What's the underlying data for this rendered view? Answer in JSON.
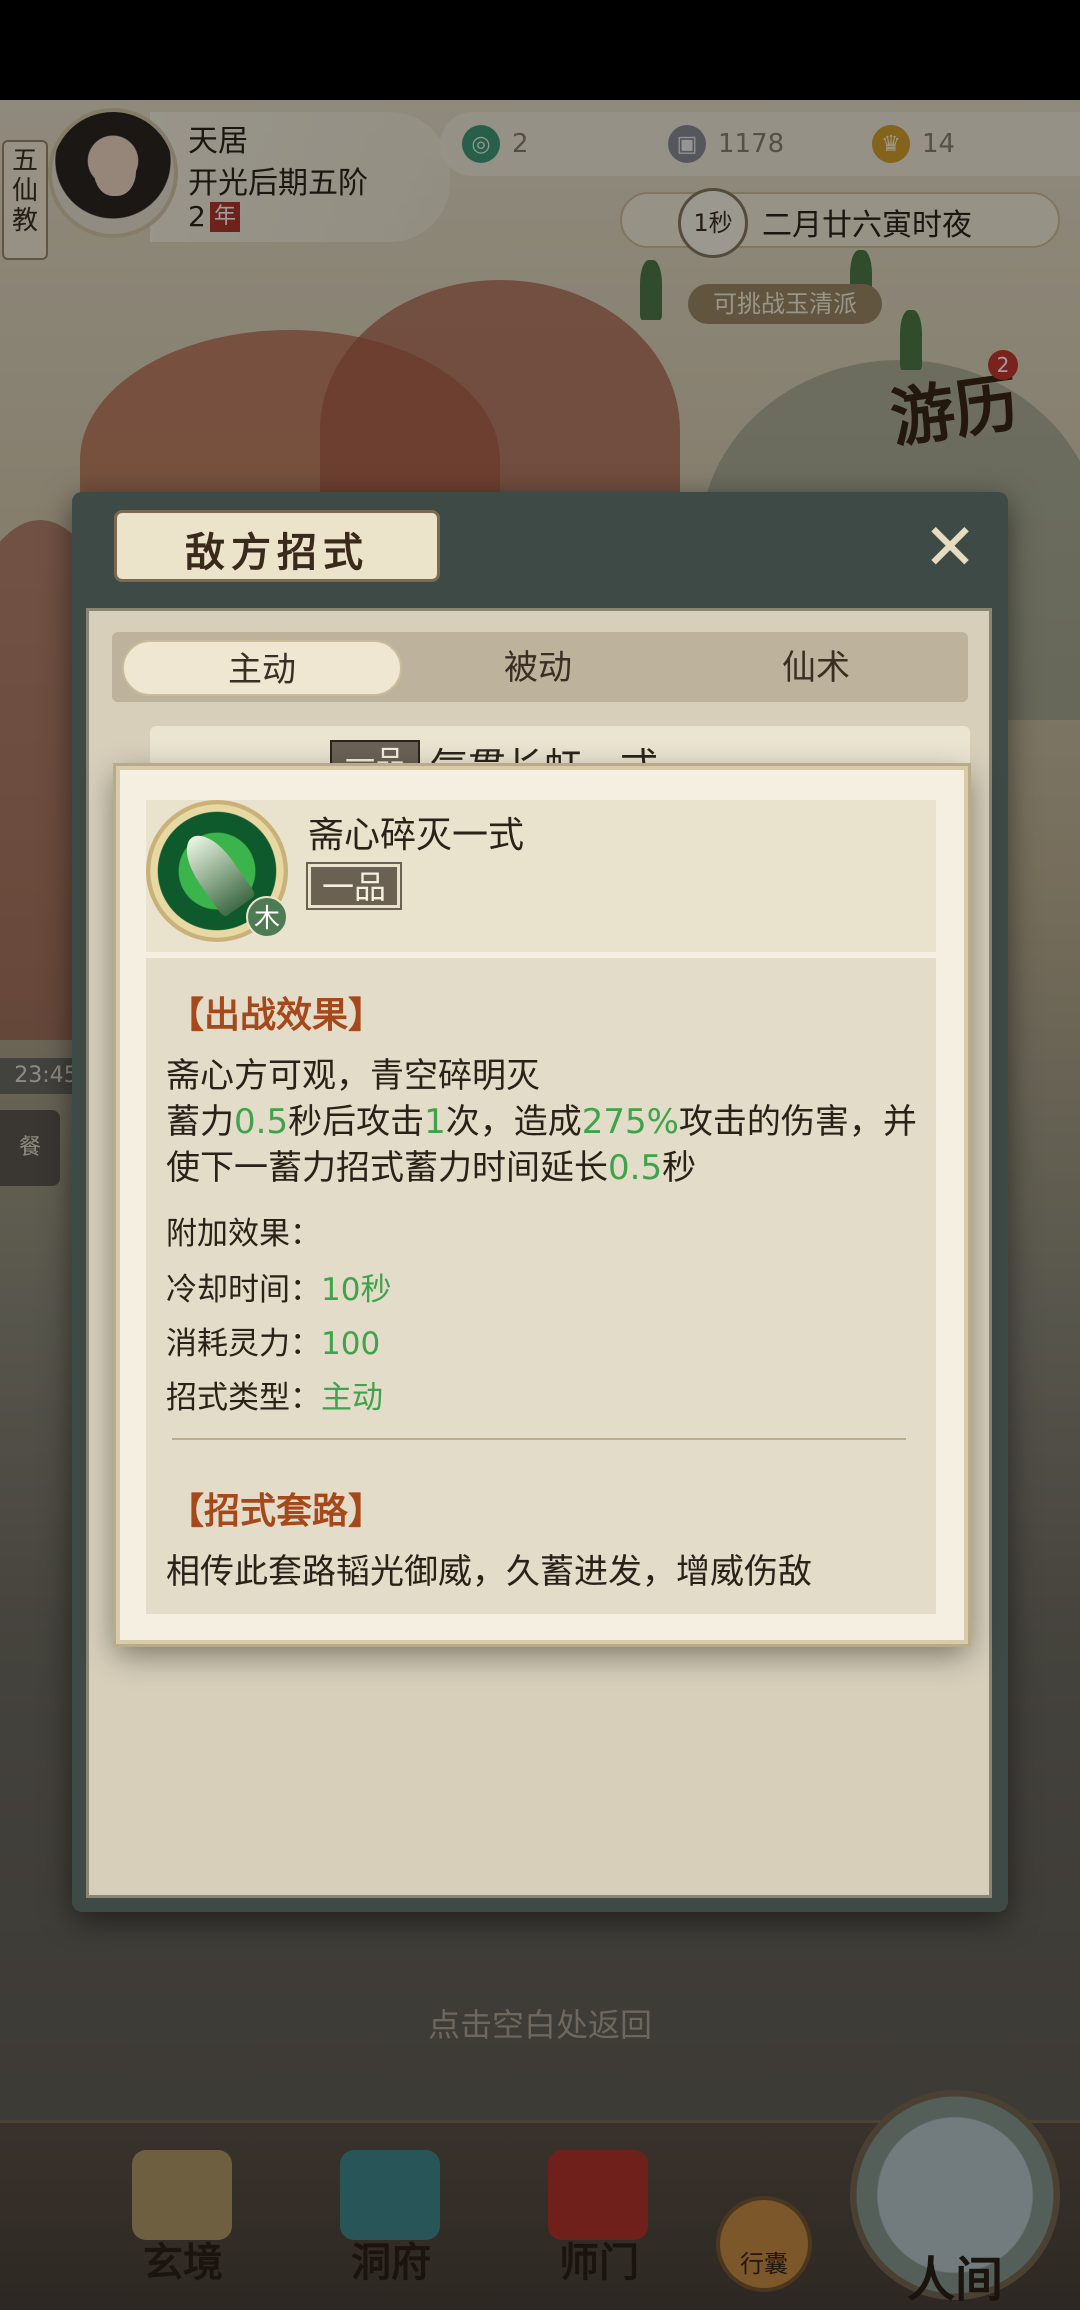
{
  "header": {
    "sect": "五仙教",
    "player": {
      "name": "天居",
      "realm": "开光后期五阶",
      "age": "2",
      "age_unit": "年"
    },
    "resources": [
      {
        "icon": "jade-swirl-icon",
        "value": "2"
      },
      {
        "icon": "silver-coin-icon",
        "value": "1178"
      },
      {
        "icon": "gold-ingot-icon",
        "value": "14"
      }
    ],
    "time": {
      "seconds": "1秒",
      "label": "二月廿六寅时夜"
    },
    "challenge": "可挑战玉清派",
    "travel": {
      "label": "游历",
      "badge": "2"
    },
    "left_clock": "23:45",
    "left_btn": "餐"
  },
  "window": {
    "title": "敌方招式",
    "tabs": [
      "主动",
      "被动",
      "仙术"
    ],
    "active_tab": 0,
    "list_peek": {
      "grade": "一品",
      "name": "气贯长虹一式"
    }
  },
  "card": {
    "skill_name": "斋心碎灭一式",
    "grade": "一品",
    "element": "木",
    "effect_title": "【出战效果】",
    "effect_line1": "斋心方可观，青空碎明灭",
    "effect_line2": {
      "p1": "蓄力",
      "v1": "0.5",
      "p2": "秒后攻击",
      "v2": "1",
      "p3": "次，造成",
      "v3": "275%",
      "p4": "攻击的伤害，并"
    },
    "effect_line3": {
      "p1": "使下一蓄力招式蓄力时间延长",
      "v1": "0.5",
      "p2": "秒"
    },
    "extra_label": "附加效果：",
    "cooldown_label": "冷却时间：",
    "cooldown_value": "10秒",
    "cost_label": "消耗灵力：",
    "cost_value": "100",
    "type_label": "招式类型：",
    "type_value": "主动",
    "routine_title": "【招式套路】",
    "routine_text": "相传此套路韬光御威，久蓄进发，增威伤敌"
  },
  "return_hint": "点击空白处返回",
  "bottom_nav": {
    "items": [
      "玄境",
      "洞府",
      "师门"
    ],
    "bag": "行囊",
    "world": "人间"
  },
  "colors": {
    "highlight_green": "#3fa34b",
    "section_title": "#a5491c",
    "card_bg": "#f4efe0"
  }
}
